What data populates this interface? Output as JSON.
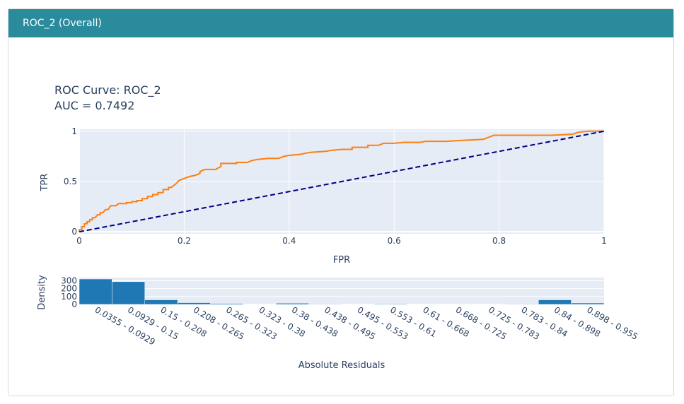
{
  "panel": {
    "title": "ROC_2 (Overall)"
  },
  "chart_data": [
    {
      "type": "line",
      "title": "ROC Curve: ROC_2",
      "subtitle": "AUC = 0.7492",
      "xlabel": "FPR",
      "ylabel": "TPR",
      "xlim": [
        0,
        1
      ],
      "ylim": [
        -0.02,
        1.02
      ],
      "xticks": [
        "0",
        "0.2",
        "0.4",
        "0.6",
        "0.8",
        "1"
      ],
      "yticks": [
        "0",
        "0.5",
        "1"
      ],
      "xtick_values": [
        0,
        0.2,
        0.4,
        0.6,
        0.8,
        1
      ],
      "ytick_values": [
        0,
        0.5,
        1
      ],
      "grid": true,
      "series": [
        {
          "color": "#ff7f0e",
          "points": [
            [
              0,
              0
            ],
            [
              0,
              0.02
            ],
            [
              0.005,
              0.02
            ],
            [
              0.005,
              0.05
            ],
            [
              0.01,
              0.05
            ],
            [
              0.01,
              0.08
            ],
            [
              0.015,
              0.08
            ],
            [
              0.015,
              0.1
            ],
            [
              0.02,
              0.1
            ],
            [
              0.02,
              0.12
            ],
            [
              0.025,
              0.12
            ],
            [
              0.025,
              0.14
            ],
            [
              0.03,
              0.14
            ],
            [
              0.035,
              0.17
            ],
            [
              0.04,
              0.17
            ],
            [
              0.04,
              0.19
            ],
            [
              0.045,
              0.19
            ],
            [
              0.05,
              0.22
            ],
            [
              0.055,
              0.22
            ],
            [
              0.06,
              0.26
            ],
            [
              0.07,
              0.26
            ],
            [
              0.075,
              0.28
            ],
            [
              0.09,
              0.28
            ],
            [
              0.09,
              0.29
            ],
            [
              0.1,
              0.29
            ],
            [
              0.1,
              0.3
            ],
            [
              0.11,
              0.3
            ],
            [
              0.11,
              0.31
            ],
            [
              0.12,
              0.31
            ],
            [
              0.12,
              0.33
            ],
            [
              0.13,
              0.33
            ],
            [
              0.13,
              0.35
            ],
            [
              0.14,
              0.35
            ],
            [
              0.14,
              0.37
            ],
            [
              0.15,
              0.37
            ],
            [
              0.15,
              0.39
            ],
            [
              0.16,
              0.39
            ],
            [
              0.16,
              0.42
            ],
            [
              0.17,
              0.42
            ],
            [
              0.17,
              0.44
            ],
            [
              0.175,
              0.44
            ],
            [
              0.18,
              0.46
            ],
            [
              0.185,
              0.48
            ],
            [
              0.19,
              0.51
            ],
            [
              0.2,
              0.53
            ],
            [
              0.21,
              0.55
            ],
            [
              0.22,
              0.56
            ],
            [
              0.23,
              0.58
            ],
            [
              0.23,
              0.6
            ],
            [
              0.24,
              0.62
            ],
            [
              0.26,
              0.62
            ],
            [
              0.27,
              0.65
            ],
            [
              0.27,
              0.68
            ],
            [
              0.3,
              0.68
            ],
            [
              0.3,
              0.69
            ],
            [
              0.32,
              0.69
            ],
            [
              0.33,
              0.71
            ],
            [
              0.34,
              0.72
            ],
            [
              0.36,
              0.73
            ],
            [
              0.38,
              0.73
            ],
            [
              0.39,
              0.75
            ],
            [
              0.4,
              0.76
            ],
            [
              0.42,
              0.77
            ],
            [
              0.44,
              0.79
            ],
            [
              0.47,
              0.8
            ],
            [
              0.48,
              0.81
            ],
            [
              0.5,
              0.82
            ],
            [
              0.52,
              0.82
            ],
            [
              0.52,
              0.84
            ],
            [
              0.55,
              0.84
            ],
            [
              0.55,
              0.86
            ],
            [
              0.57,
              0.86
            ],
            [
              0.58,
              0.88
            ],
            [
              0.6,
              0.88
            ],
            [
              0.62,
              0.89
            ],
            [
              0.65,
              0.89
            ],
            [
              0.66,
              0.9
            ],
            [
              0.7,
              0.9
            ],
            [
              0.73,
              0.91
            ],
            [
              0.77,
              0.92
            ],
            [
              0.78,
              0.94
            ],
            [
              0.79,
              0.96
            ],
            [
              0.82,
              0.96
            ],
            [
              0.86,
              0.96
            ],
            [
              0.9,
              0.96
            ],
            [
              0.94,
              0.97
            ],
            [
              0.95,
              0.99
            ],
            [
              0.97,
              1.0
            ],
            [
              1.0,
              1.0
            ]
          ]
        },
        {
          "color": "#000080",
          "dash": true,
          "points": [
            [
              0,
              0
            ],
            [
              1,
              1
            ]
          ]
        }
      ]
    },
    {
      "type": "bar",
      "xlabel": "Absolute Residuals",
      "ylabel": "Density",
      "yticks": [
        "0",
        "100",
        "200",
        "300"
      ],
      "ytick_values": [
        0,
        100,
        200,
        300
      ],
      "ylim": [
        0,
        340
      ],
      "color": "#1f77b4",
      "categories": [
        "0.0355 - 0.0929",
        "0.0929 - 0.15",
        "0.15 - 0.208",
        "0.208 - 0.265",
        "0.265 - 0.323",
        "0.323 - 0.38",
        "0.38 - 0.438",
        "0.438 - 0.495",
        "0.495 - 0.553",
        "0.553 - 0.61",
        "0.61 - 0.668",
        "0.668 - 0.725",
        "0.725 - 0.783",
        "0.783 - 0.84",
        "0.84 - 0.898",
        "0.898 - 0.955"
      ],
      "values": [
        322,
        288,
        58,
        22,
        12,
        4,
        15,
        6,
        4,
        8,
        3,
        3,
        3,
        6,
        58,
        18
      ]
    }
  ]
}
